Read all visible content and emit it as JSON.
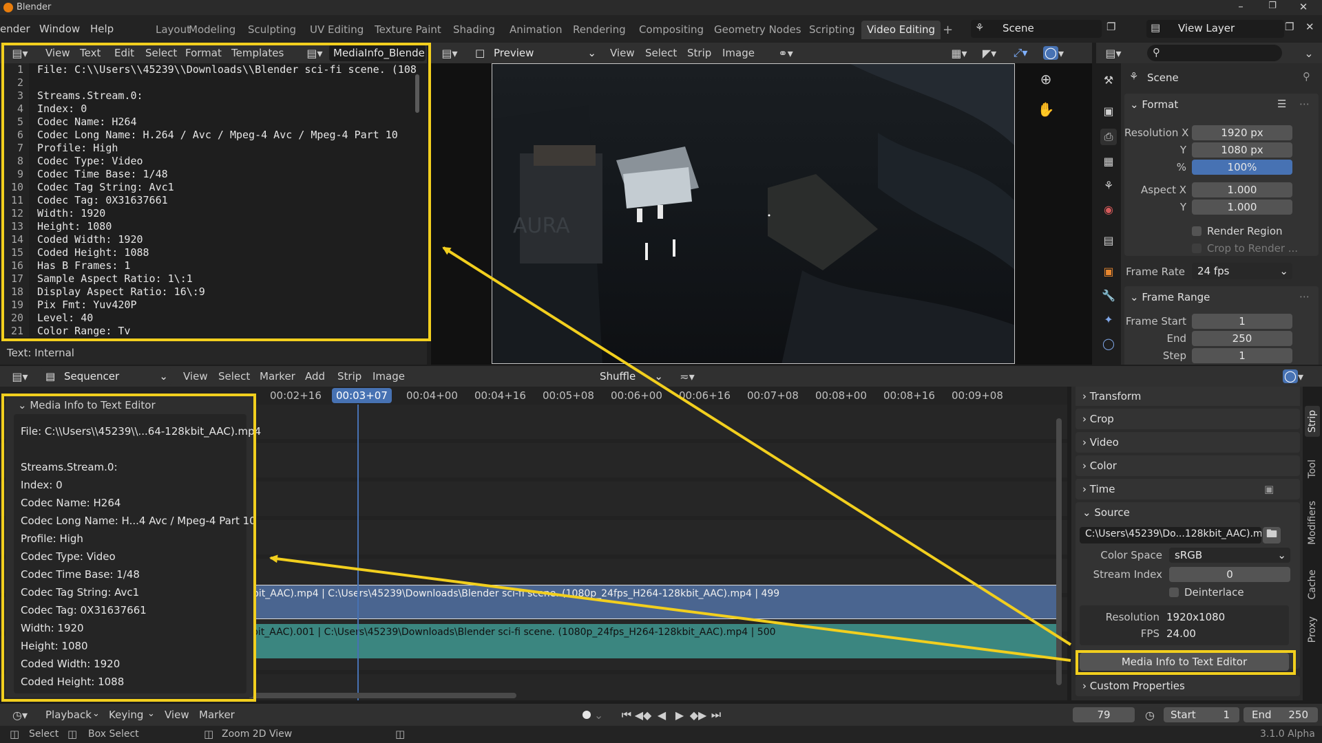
{
  "window": {
    "title": "Blender"
  },
  "menubar": {
    "items": [
      "ender",
      "Window",
      "Help"
    ]
  },
  "workspaces": [
    "Layout",
    "Modeling",
    "Sculpting",
    "UV Editing",
    "Texture Paint",
    "Shading",
    "Animation",
    "Rendering",
    "Compositing",
    "Geometry Nodes",
    "Scripting",
    "Video Editing"
  ],
  "active_workspace": "Video Editing",
  "add_tab": "+",
  "scene": {
    "name": "Scene"
  },
  "view_layer": {
    "name": "View Layer"
  },
  "text_editor": {
    "menus": [
      "View",
      "Text",
      "Edit",
      "Select",
      "Format",
      "Templates"
    ],
    "file_name": "MediaInfo_Blender s",
    "status": "Text: Internal",
    "lines": [
      {
        "n": "1",
        "t": "File: C:\\\\Users\\\\45239\\\\Downloads\\\\Blender sci-fi scene. (108"
      },
      {
        "n": "2",
        "t": ""
      },
      {
        "n": "3",
        "t": "Streams.Stream.0:"
      },
      {
        "n": "4",
        "t": "Index: 0"
      },
      {
        "n": "5",
        "t": "Codec Name: H264"
      },
      {
        "n": "6",
        "t": "Codec Long Name: H.264 / Avc / Mpeg-4 Avc / Mpeg-4 Part 10"
      },
      {
        "n": "7",
        "t": "Profile: High"
      },
      {
        "n": "8",
        "t": "Codec Type: Video"
      },
      {
        "n": "9",
        "t": "Codec Time Base: 1/48"
      },
      {
        "n": "10",
        "t": "Codec Tag String: Avc1"
      },
      {
        "n": "11",
        "t": "Codec Tag: 0X31637661"
      },
      {
        "n": "12",
        "t": "Width: 1920"
      },
      {
        "n": "13",
        "t": "Height: 1080"
      },
      {
        "n": "14",
        "t": "Coded Width: 1920"
      },
      {
        "n": "15",
        "t": "Coded Height: 1088"
      },
      {
        "n": "16",
        "t": "Has B Frames: 1"
      },
      {
        "n": "17",
        "t": "Sample Aspect Ratio: 1\\:1"
      },
      {
        "n": "18",
        "t": "Display Aspect Ratio: 16\\:9"
      },
      {
        "n": "19",
        "t": "Pix Fmt: Yuv420P"
      },
      {
        "n": "20",
        "t": "Level: 40"
      },
      {
        "n": "21",
        "t": "Color Range: Tv"
      }
    ]
  },
  "preview": {
    "mode": "Preview",
    "menus": [
      "View",
      "Select",
      "Strip",
      "Image"
    ],
    "sign_text": "AURA"
  },
  "properties": {
    "search_placeholder": "",
    "context": "Scene",
    "format": {
      "title": "Format",
      "res_x_label": "Resolution X",
      "res_x": "1920 px",
      "res_y_label": "Y",
      "res_y": "1080 px",
      "pct_label": "%",
      "pct": "100%",
      "aspect_x_label": "Aspect X",
      "aspect_x": "1.000",
      "aspect_y_label": "Y",
      "aspect_y": "1.000",
      "render_region": "Render Region",
      "crop_region": "Crop to Render ...",
      "frame_rate_label": "Frame Rate",
      "frame_rate": "24 fps"
    },
    "frame_range": {
      "title": "Frame Range",
      "start_label": "Frame Start",
      "start": "1",
      "end_label": "End",
      "end": "250",
      "step_label": "Step",
      "step": "1"
    }
  },
  "sequencer": {
    "mode": "Sequencer",
    "menus": [
      "View",
      "Select",
      "Marker",
      "Add",
      "Strip",
      "Image"
    ],
    "overlap_mode": "Shuffle",
    "ruler": [
      "00:02+16",
      "00:03+07",
      "00:04+00",
      "00:04+16",
      "00:05+08",
      "00:06+00",
      "00:06+16",
      "00:07+08",
      "00:08+00",
      "00:08+16",
      "00:09+08"
    ],
    "current_time": "00:03+07",
    "strip_video": "pit_AAC).mp4 | C:\\Users\\45239\\Downloads\\Blender sci-fi scene. (1080p_24fps_H264-128kbit_AAC).mp4 | 499",
    "strip_audio": "bit_AAC).001 | C:\\Users\\45239\\Downloads\\Blender sci-fi scene. (1080p_24fps_H264-128kbit_AAC).mp4 | 500"
  },
  "media_panel": {
    "title": "Media Info to Text Editor",
    "lines": [
      "File: C:\\\\Users\\\\45239\\\\...64-128kbit_AAC).mp4",
      "",
      "Streams.Stream.0:",
      "Index: 0",
      "Codec Name: H264",
      "Codec Long Name: H...4 Avc / Mpeg-4 Part 10",
      "Profile: High",
      "Codec Type: Video",
      "Codec Time Base: 1/48",
      "Codec Tag String: Avc1",
      "Codec Tag: 0X31637661",
      "Width: 1920",
      "Height: 1080",
      "Coded Width: 1920",
      "Coded Height: 1088"
    ]
  },
  "strip_sidebar": {
    "panels": [
      "Transform",
      "Crop",
      "Video",
      "Color",
      "Time"
    ],
    "source": {
      "title": "Source",
      "path": "C:\\Users\\45239\\Do...128kbit_AAC).mp4",
      "color_space_label": "Color Space",
      "color_space": "sRGB",
      "stream_index_label": "Stream Index",
      "stream_index": "0",
      "deinterlace": "Deinterlace",
      "resolution_label": "Resolution",
      "resolution": "1920x1080",
      "fps_label": "FPS",
      "fps": "24.00"
    },
    "action_button": "Media Info to Text Editor",
    "custom_properties": "Custom Properties",
    "tabs": [
      "Strip",
      "Tool",
      "Modifiers",
      "Cache",
      "Proxy"
    ]
  },
  "timeline": {
    "menus": [
      "Playback",
      "Keying",
      "View",
      "Marker"
    ],
    "current_frame": "79",
    "start_label": "Start",
    "start": "1",
    "end_label": "End",
    "end": "250"
  },
  "statusbar": {
    "select": "Select",
    "box_select": "Box Select",
    "zoom": "Zoom 2D View",
    "version": "3.1.0 Alpha"
  },
  "colors": {
    "annotation": "#f2cf1e",
    "accent": "#4772b3",
    "strip_video": "#4a6590",
    "strip_audio": "#3b8680"
  }
}
